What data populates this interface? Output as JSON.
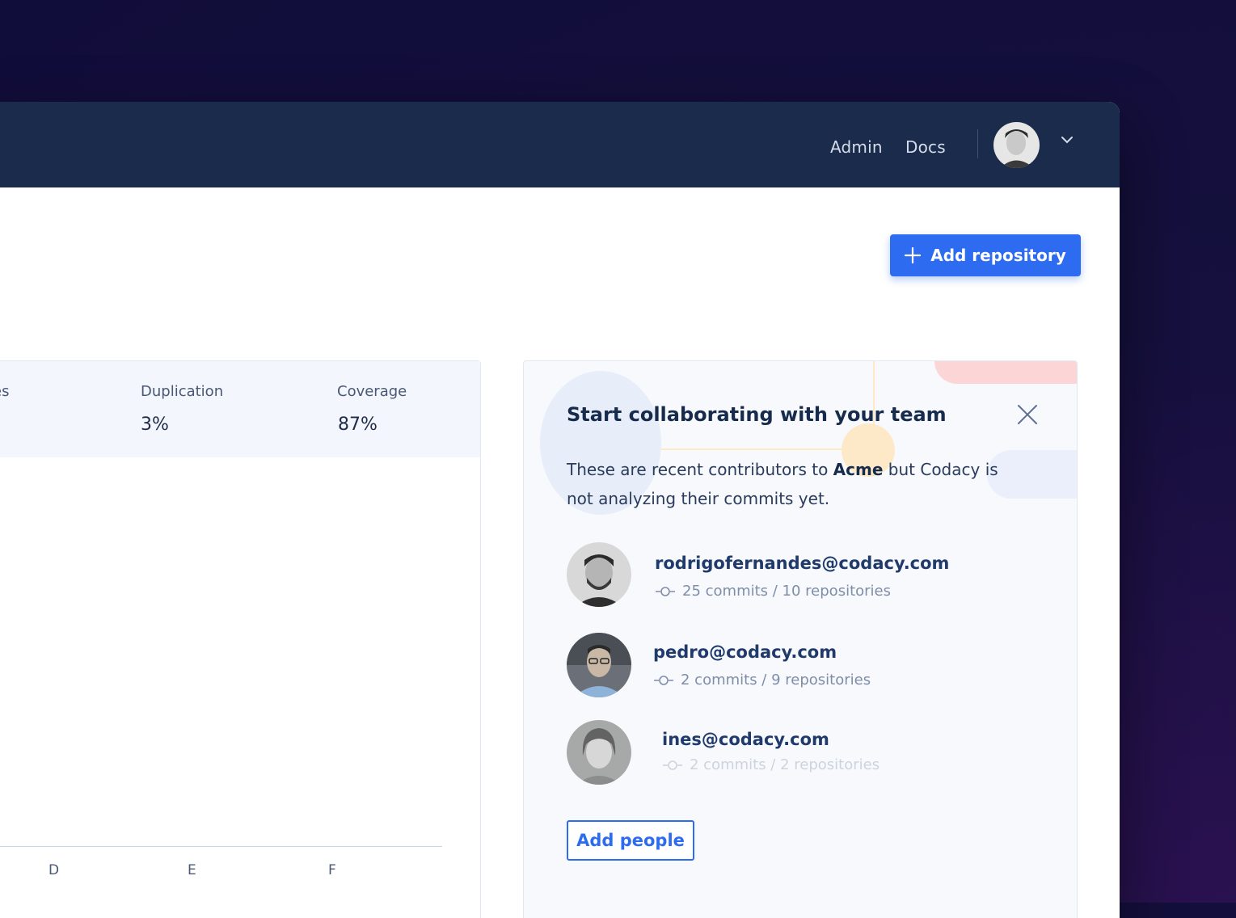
{
  "topbar": {
    "admin_label": "Admin",
    "docs_label": "Docs"
  },
  "toolbar": {
    "add_repository_label": "Add repository"
  },
  "metrics": [
    {
      "label": "es",
      "value": ""
    },
    {
      "label": "Duplication",
      "value": "3%"
    },
    {
      "label": "Coverage",
      "value": "87%"
    }
  ],
  "chart_axis": {
    "ticks": [
      "D",
      "E",
      "F"
    ]
  },
  "collab": {
    "title": "Start collaborating with your team",
    "desc_pre": "These are recent contributors to ",
    "repo_name": "Acme",
    "desc_post": " but Codacy is not analyzing their commits yet.",
    "people": [
      {
        "email": "rodrigofernandes@codacy.com",
        "meta": "25 commits / 10 repositories"
      },
      {
        "email": "pedro@codacy.com",
        "meta": "2 commits / 9 repositories"
      },
      {
        "email": "ines@codacy.com",
        "meta": "2 commits / 2 repositories"
      }
    ],
    "add_people_label": "Add people"
  },
  "colors": {
    "accent": "#2d6cf0",
    "topbar": "#1a2b4b",
    "background": "#110d3a"
  }
}
